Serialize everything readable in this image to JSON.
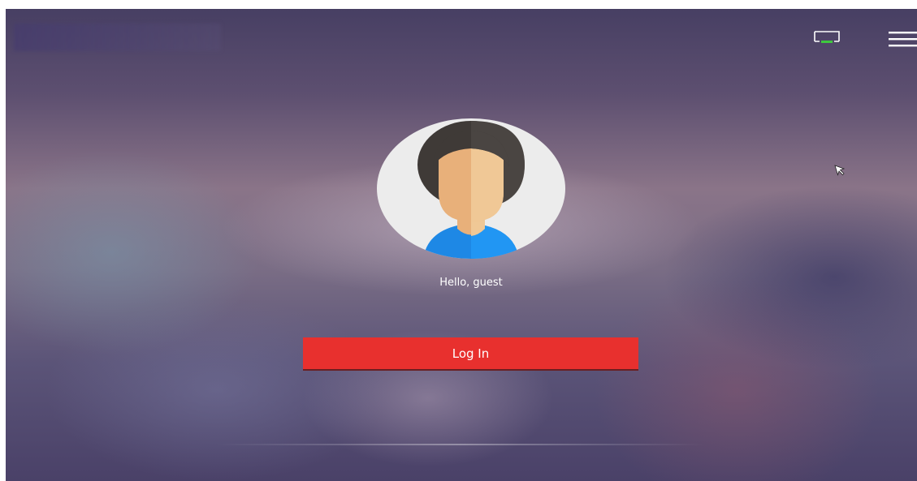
{
  "header": {
    "display_icon": "monitor-icon",
    "menu_icon": "hamburger-menu-icon"
  },
  "profile": {
    "avatar_icon": "user-avatar-icon",
    "greeting": "Hello, guest"
  },
  "actions": {
    "login_label": "Log In"
  },
  "colors": {
    "login_button": "#e8302e",
    "monitor_indicator": "#3ec83e",
    "avatar_background": "#ececec",
    "avatar_hair": "#3f3a37",
    "avatar_face_left": "#e8b07a",
    "avatar_face_right": "#f0c896",
    "avatar_shirt": "#1e88e5"
  }
}
